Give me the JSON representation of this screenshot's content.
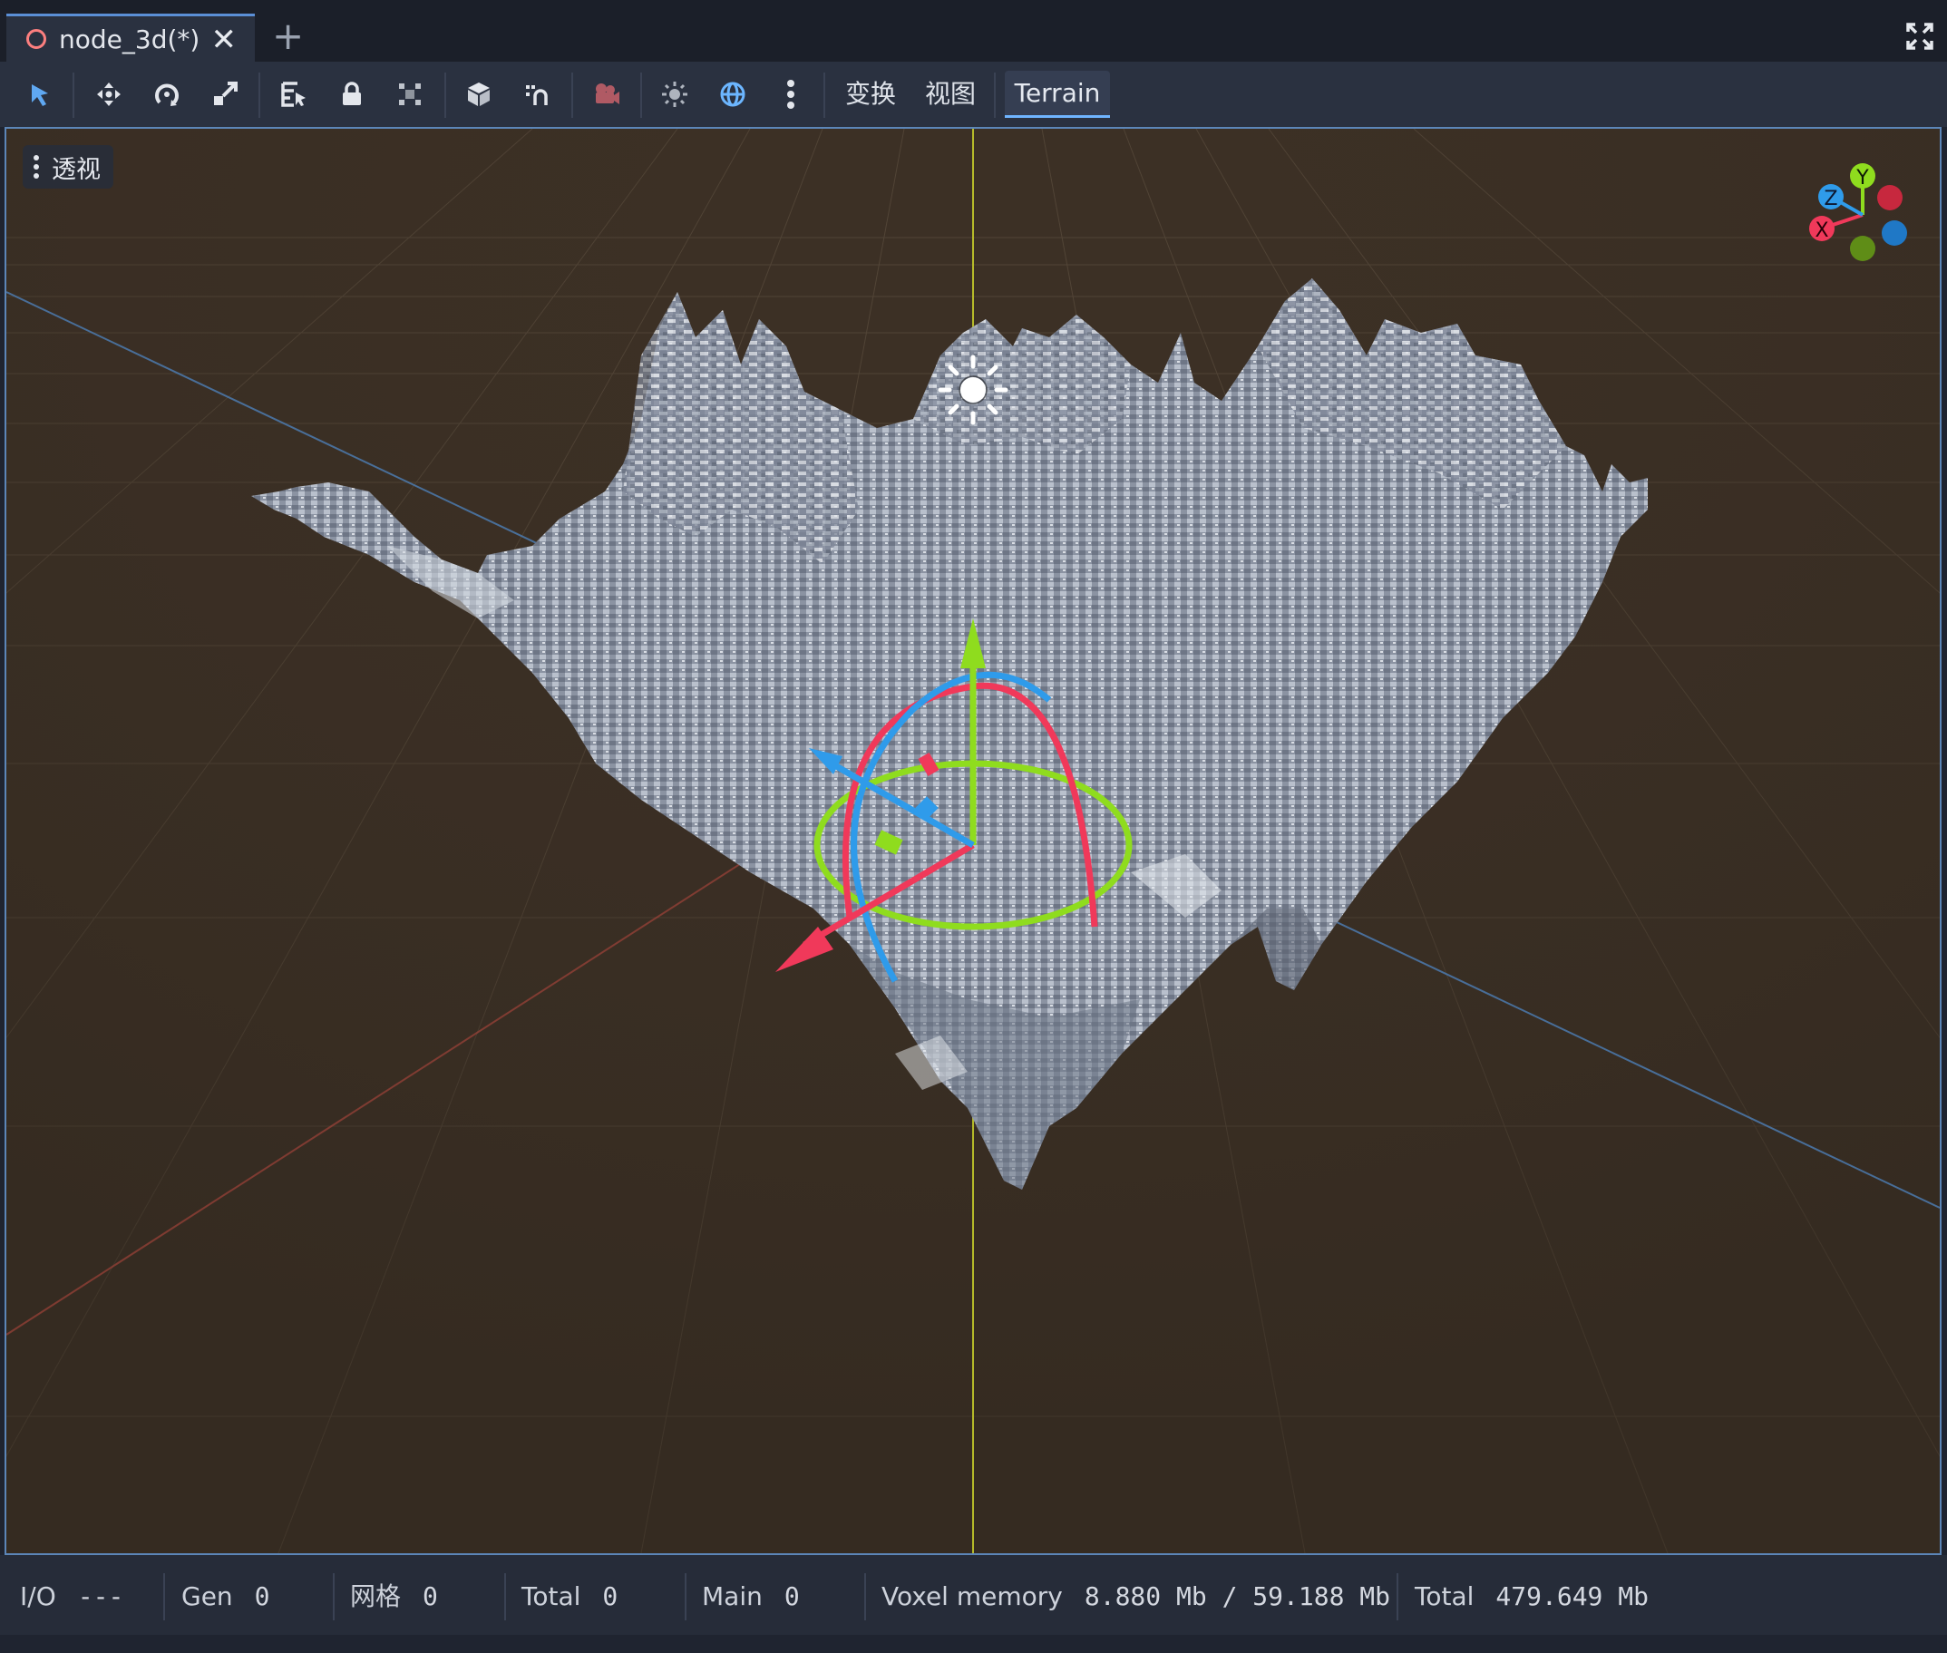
{
  "tabs": {
    "active_label": "node_3d(*)",
    "close_glyph": "✕",
    "add_glyph": "+"
  },
  "toolbar": {
    "tools": [
      {
        "icon": "select-arrow-icon"
      },
      {
        "icon": "move-icon"
      },
      {
        "icon": "rotate-icon"
      },
      {
        "icon": "scale-icon"
      },
      {
        "icon": "list-select-icon"
      },
      {
        "icon": "lock-icon"
      },
      {
        "icon": "group-icon"
      },
      {
        "icon": "local-space-icon"
      },
      {
        "icon": "snap-icon"
      },
      {
        "icon": "camera-preview-icon"
      },
      {
        "icon": "sun-preview-icon"
      },
      {
        "icon": "environment-preview-icon"
      },
      {
        "icon": "more-kebab-icon"
      }
    ],
    "menu_transform": "变换",
    "menu_view": "视图",
    "menu_terrain": "Terrain"
  },
  "viewport": {
    "perspective_label": "透视",
    "axes": {
      "x": "X",
      "y": "Y",
      "z": "Z"
    },
    "colors": {
      "background": "#3c3025",
      "terrain": "#8e96a5",
      "axis_x": "#f0395a",
      "axis_y": "#8fdc1e",
      "axis_z": "#2f9bea"
    }
  },
  "status": {
    "io_label": "I/O",
    "io_value": "---",
    "gen_label": "Gen",
    "gen_value": "0",
    "mesh_label": "网格",
    "mesh_value": "0",
    "total_label": "Total",
    "total_value": "0",
    "main_label": "Main",
    "main_value": "0",
    "voxel_label": "Voxel memory",
    "voxel_value": "8.880 Mb / 59.188 Mb",
    "total_mem_label": "Total",
    "total_mem_value": "479.649 Mb"
  }
}
